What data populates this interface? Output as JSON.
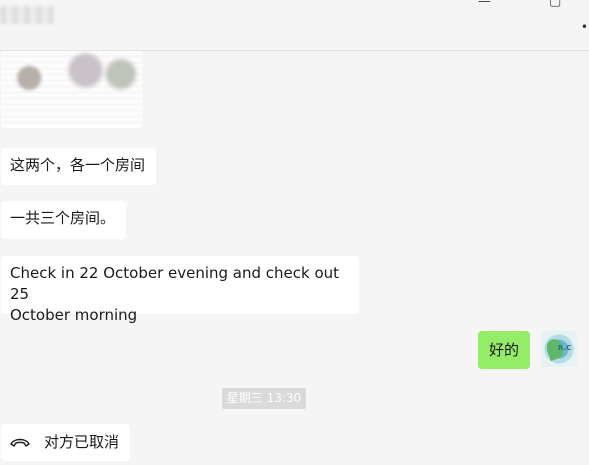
{
  "window": {
    "title": "",
    "controls": [
      "minimize-icon",
      "maximize-icon"
    ],
    "more": "more-icon"
  },
  "messages": [
    {
      "type": "image",
      "sender": "other",
      "blurred": true
    },
    {
      "type": "text",
      "sender": "other",
      "text": "这两个，各一个房间"
    },
    {
      "type": "text",
      "sender": "other",
      "text": "一共三个房间。"
    },
    {
      "type": "text",
      "sender": "other",
      "text": "Check in 22 October evening and check out 25\nOctober morning"
    },
    {
      "type": "text",
      "sender": "self",
      "text": "好的"
    },
    {
      "type": "timestamp",
      "text": "星期三 13:30"
    },
    {
      "type": "call",
      "sender": "other",
      "icon": "phone-hangup-icon",
      "text": "对方已取消"
    }
  ],
  "colors": {
    "background": "#f5f5f5",
    "other_bubble": "#ffffff",
    "self_bubble": "#95ec69",
    "timestamp_bg": "#dadada"
  }
}
